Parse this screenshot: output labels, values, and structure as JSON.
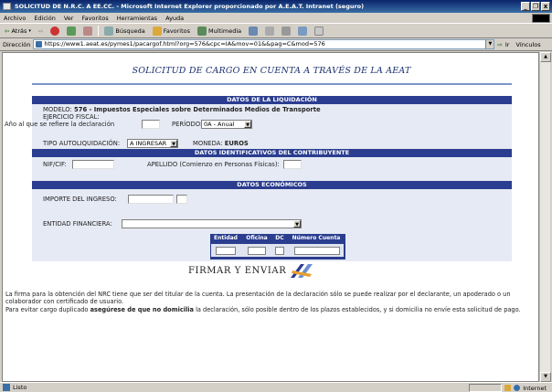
{
  "window": {
    "title": "SOLICITUD DE N.R.C. A EE.CC. - Microsoft Internet Explorer proporcionado por A.E.A.T. Intranet (seguro)",
    "buttons": [
      "_",
      "❐",
      "x"
    ]
  },
  "menu": [
    "Archivo",
    "Edición",
    "Ver",
    "Favoritos",
    "Herramientas",
    "Ayuda"
  ],
  "toolbar": {
    "back": "Atrás",
    "search": "Búsqueda",
    "favorites": "Favoritos",
    "multimedia": "Multimedia"
  },
  "address": {
    "label": "Dirección",
    "url": "https://www1.aeat.es/pymes1/pacargof.html?org=576&cpc=IA&mov=01&&pag=C&mod=576",
    "go": "Ir",
    "links": "Vínculos"
  },
  "page": {
    "title": "SOLICITUD DE CARGO EN CUENTA A TRAVÉS DE LA AEAT",
    "sections": {
      "liquidacion": "DATOS DE LA LIQUIDACIÓN",
      "contribuyente": "DATOS IDENTIFICATIVOS DEL CONTRIBUYENTE",
      "economicos": "DATOS ECONÓMICOS"
    },
    "modelo_label": "MODELO:",
    "modelo_value": "576 - Impuestos Especiales sobre Determinados Medios de Transporte",
    "ejercicio_label": "EJERCICIO FISCAL:",
    "ejercicio_sub": "Año al que se refiere la declaración",
    "periodo_label": "PERÍODO:",
    "periodo_value": "0A - Anual",
    "tipo_label": "TIPO AUTOLIQUIDACIÓN:",
    "tipo_value": "A INGRESAR",
    "moneda_label": "MONEDA:",
    "moneda_value": "EUROS",
    "nif_label": "NIF/CIF:",
    "apellido_label": "APELLIDO (Comienzo en Personas Físicas):",
    "importe_label": "IMPORTE DEL INGRESO:",
    "entidad_label": "ENTIDAD FINANCIERA:",
    "bank_headers": [
      "Entidad",
      "Oficina",
      "DC",
      "Número Cuenta"
    ],
    "submit_label": "FIRMAR Y ENVIAR",
    "note1": "La firma para la obtención del NRC tiene que ser del titular de la cuenta. La presentación de la declaración sólo se puede realizar por el declarante, un apoderado o un colaborador con certificado de usuario.",
    "note2_pre": "Para evitar cargo duplicado ",
    "note2_bold": "asegúrese de que no domicilia",
    "note2_post": " la declaración, sólo posible dentro de los plazos establecidos, y si domicilia no envíe esta solicitud de pago."
  },
  "status": {
    "text": "Listo",
    "zone": "Internet"
  }
}
